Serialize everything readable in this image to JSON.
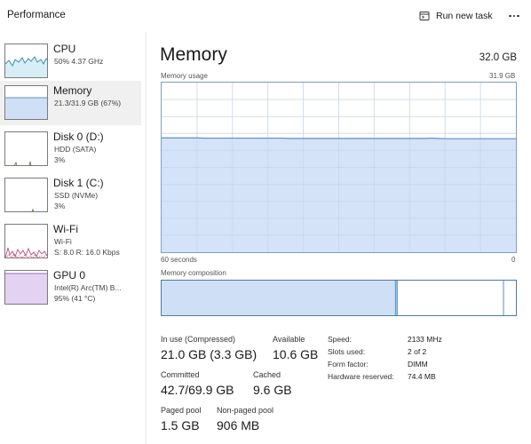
{
  "header": {
    "title": "Performance",
    "run_new_task": "Run new task"
  },
  "colors": {
    "memory_fill": "#cfe0f6",
    "memory_line": "#5b8fc9",
    "grid": "#dfe7f0",
    "cpu_line": "#3a8fb5",
    "wifi_line": "#c24a78",
    "gpu_fill": "#e4d2f3",
    "disk_line": "#4f9a3a"
  },
  "sidebar": {
    "items": [
      {
        "name": "CPU",
        "sub1": "50% 4.37 GHz",
        "sub2": ""
      },
      {
        "name": "Memory",
        "sub1": "21.3/31.9 GB (67%)",
        "sub2": ""
      },
      {
        "name": "Disk 0 (D:)",
        "sub1": "HDD (SATA)",
        "sub2": "3%"
      },
      {
        "name": "Disk 1 (C:)",
        "sub1": "SSD (NVMe)",
        "sub2": "3%"
      },
      {
        "name": "Wi-Fi",
        "sub1": "Wi-Fi",
        "sub2": "S: 8.0 R: 16.0 Kbps"
      },
      {
        "name": "GPU 0",
        "sub1": "Intel(R) Arc(TM) B...",
        "sub2": "95% (41 °C)"
      }
    ]
  },
  "main": {
    "title": "Memory",
    "capacity": "32.0 GB",
    "usage_label": "Memory usage",
    "usage_max": "31.9 GB",
    "time_left": "60 seconds",
    "time_right": "0",
    "composition_label": "Memory composition",
    "composition": {
      "in_use_fraction": 0.66,
      "modified_fraction": 0.003,
      "standby_fraction": 0.3
    }
  },
  "chart_data": {
    "type": "area",
    "title": "Memory usage",
    "xlabel": "60 seconds",
    "ylabel": "",
    "ylim": [
      0,
      31.9
    ],
    "grid": true,
    "series": [
      {
        "values": [
          21.5,
          21.5,
          21.5,
          21.5,
          21.5,
          21.5,
          21.5,
          21.45,
          21.45,
          21.45,
          21.45,
          21.45,
          21.45,
          21.45,
          21.45,
          21.45,
          21.45,
          21.45,
          21.45,
          21.45,
          21.45,
          21.4,
          21.4,
          21.4,
          21.4,
          21.4,
          21.4,
          21.4,
          21.4,
          21.4,
          21.4,
          21.4,
          21.4,
          21.4,
          21.4,
          21.4,
          21.4,
          21.4,
          21.4,
          21.4,
          21.4,
          21.4,
          21.4,
          21.4,
          21.4,
          21.45,
          21.4,
          21.35,
          21.35,
          21.35,
          21.35,
          21.35,
          21.35,
          21.35,
          21.35,
          21.35,
          21.35,
          21.35,
          21.35,
          21.35
        ]
      }
    ]
  },
  "stats": {
    "in_use": {
      "label": "In use (Compressed)",
      "value": "21.0 GB (3.3 GB)"
    },
    "available": {
      "label": "Available",
      "value": "10.6 GB"
    },
    "committed": {
      "label": "Committed",
      "value": "42.7/69.9 GB"
    },
    "cached": {
      "label": "Cached",
      "value": "9.6 GB"
    },
    "paged_pool": {
      "label": "Paged pool",
      "value": "1.5 GB"
    },
    "nonpaged_pool": {
      "label": "Non-paged pool",
      "value": "906 MB"
    }
  },
  "properties": {
    "speed": {
      "label": "Speed:",
      "value": "2133 MHz"
    },
    "slots": {
      "label": "Slots used:",
      "value": "2 of 2"
    },
    "form_factor": {
      "label": "Form factor:",
      "value": "DIMM"
    },
    "hw_reserved": {
      "label": "Hardware reserved:",
      "value": "74.4 MB"
    }
  }
}
